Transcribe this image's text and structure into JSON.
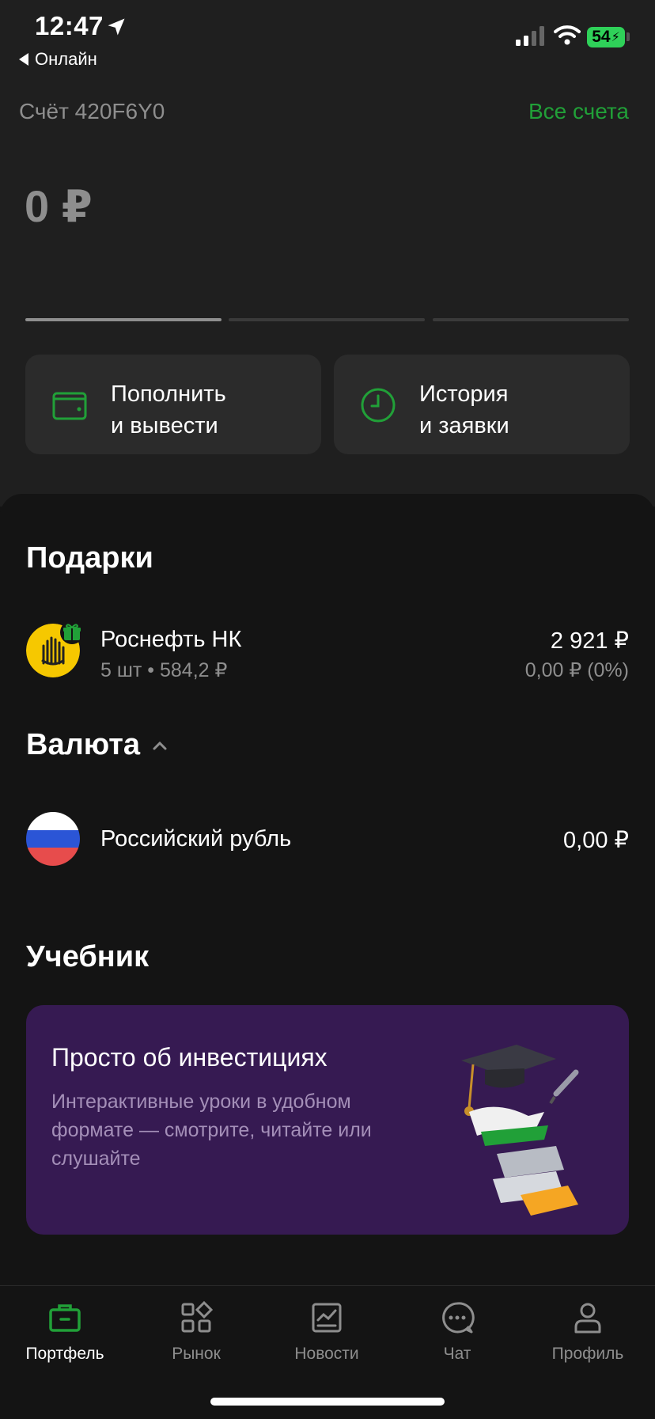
{
  "status_bar": {
    "time": "12:47",
    "back_app": "Онлайн",
    "battery": "54"
  },
  "header": {
    "account_label": "Счёт 420F6Y0",
    "all_accounts": "Все счета",
    "balance": "0 ₽"
  },
  "actions": [
    {
      "label_line1": "Пополнить",
      "label_line2": "и вывести",
      "icon": "wallet-icon"
    },
    {
      "label_line1": "История",
      "label_line2": "и заявки",
      "icon": "clock-icon"
    }
  ],
  "gifts": {
    "title": "Подарки",
    "items": [
      {
        "name": "Роснефть НК",
        "sub": "5 шт • 584,2 ₽",
        "value": "2 921 ₽",
        "change": "0,00 ₽ (0%)",
        "icon": "rosneft-logo"
      }
    ]
  },
  "currency": {
    "title": "Валюта",
    "items": [
      {
        "name": "Российский рубль",
        "value": "0,00 ₽",
        "icon": "russia-flag-icon"
      }
    ]
  },
  "textbook": {
    "title": "Учебник",
    "card_title": "Просто об инвестициях",
    "card_desc": "Интерактивные уроки в удобном формате — смотрите, читайте или слушайте"
  },
  "tabs": [
    {
      "label": "Портфель",
      "icon": "briefcase-icon",
      "active": true
    },
    {
      "label": "Рынок",
      "icon": "market-grid-icon",
      "active": false
    },
    {
      "label": "Новости",
      "icon": "news-chart-icon",
      "active": false
    },
    {
      "label": "Чат",
      "icon": "chat-icon",
      "active": false
    },
    {
      "label": "Профиль",
      "icon": "profile-icon",
      "active": false
    }
  ],
  "colors": {
    "accent": "#21a038",
    "background": "#141414",
    "card": "#2b2b2b",
    "edu_card": "#361a52"
  }
}
